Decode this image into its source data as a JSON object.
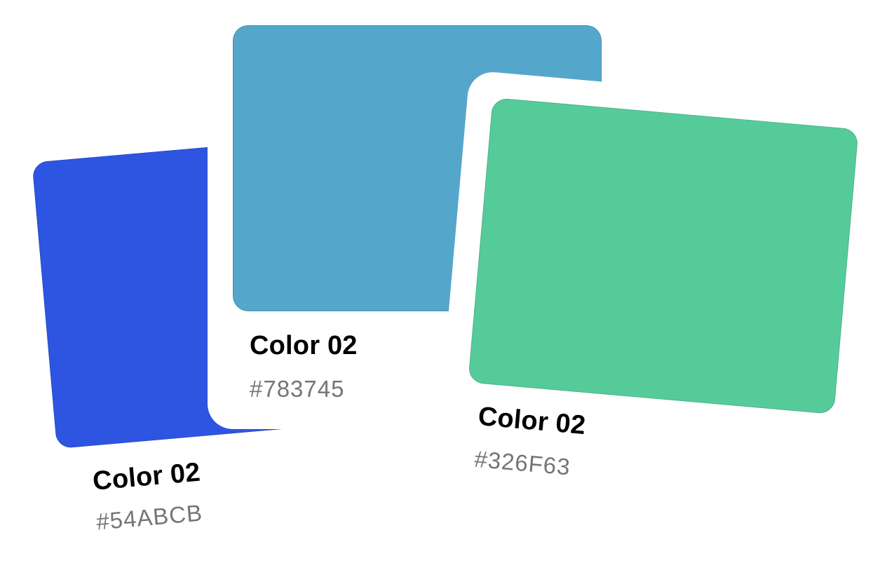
{
  "cards": [
    {
      "name": "Color 02",
      "hex": "#54ABCB",
      "swatch_color": "#2D55E2"
    },
    {
      "name": "Color 02",
      "hex": "#783745",
      "swatch_color": "#55A6CB"
    },
    {
      "name": "Color 02",
      "hex": "#326F63",
      "swatch_color": "#56CB9A"
    }
  ]
}
